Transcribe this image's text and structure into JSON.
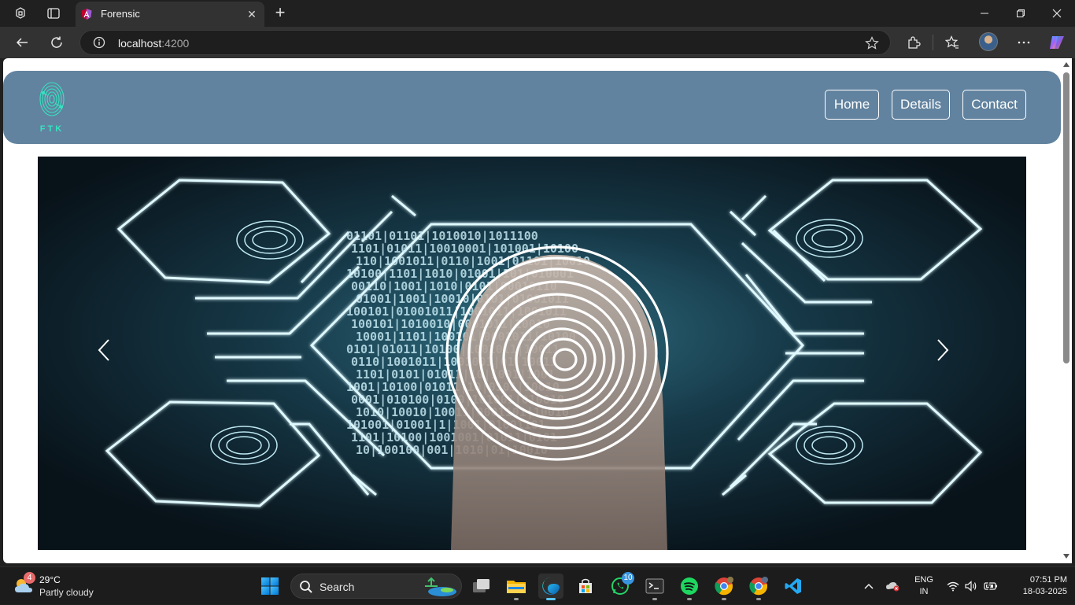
{
  "browser": {
    "tab_title": "Forensic",
    "tab_close": "✕",
    "new_tab": "+",
    "url_host": "localhost",
    "url_port": ":4200"
  },
  "site": {
    "logo_text": "FTK",
    "nav": [
      {
        "label": "Home"
      },
      {
        "label": "Details"
      },
      {
        "label": "Contact"
      }
    ],
    "hero_binary_rows": [
      "01101|01101|1010010|1011100",
      "1101|01011|10010001|101001|10100",
      "110|1001011|0110|1001|01101|10010",
      "10100|1101|1010|01001|101|010001",
      "00110|1001|1010|0101|00010110",
      "01001|1001|10010|0101|01001011",
      "100101|01001011|1001011|1001011",
      "100101|1010010|0001011|10010",
      "10001|1101|100101|0001011|10100",
      "0101|01011|10100|1001011|10011",
      "0110|1001011|1001001|01|10011",
      "1101|0101|01011|10|1001|1001",
      "1001|10100|01011|10|0101|10010",
      "0001|010100|0100|101001|010010",
      "1010|10010|10011|0001101|10010",
      "101001|01001|1|1001|01001101",
      "1101|10100|1001001|01011|0101",
      "10|100100|001|1010|01|10010"
    ]
  },
  "taskbar": {
    "weather_temp": "29°C",
    "weather_desc": "Partly cloudy",
    "weather_badge": "4",
    "search_label": "Search",
    "whatsapp_badge": "10",
    "lang_line1": "ENG",
    "lang_line2": "IN",
    "time": "07:51 PM",
    "date": "18-03-2025"
  },
  "colors": {
    "header_bg": "#62839f",
    "logo_accent": "#35e3c0",
    "hero_glow": "#7fe9ff"
  }
}
